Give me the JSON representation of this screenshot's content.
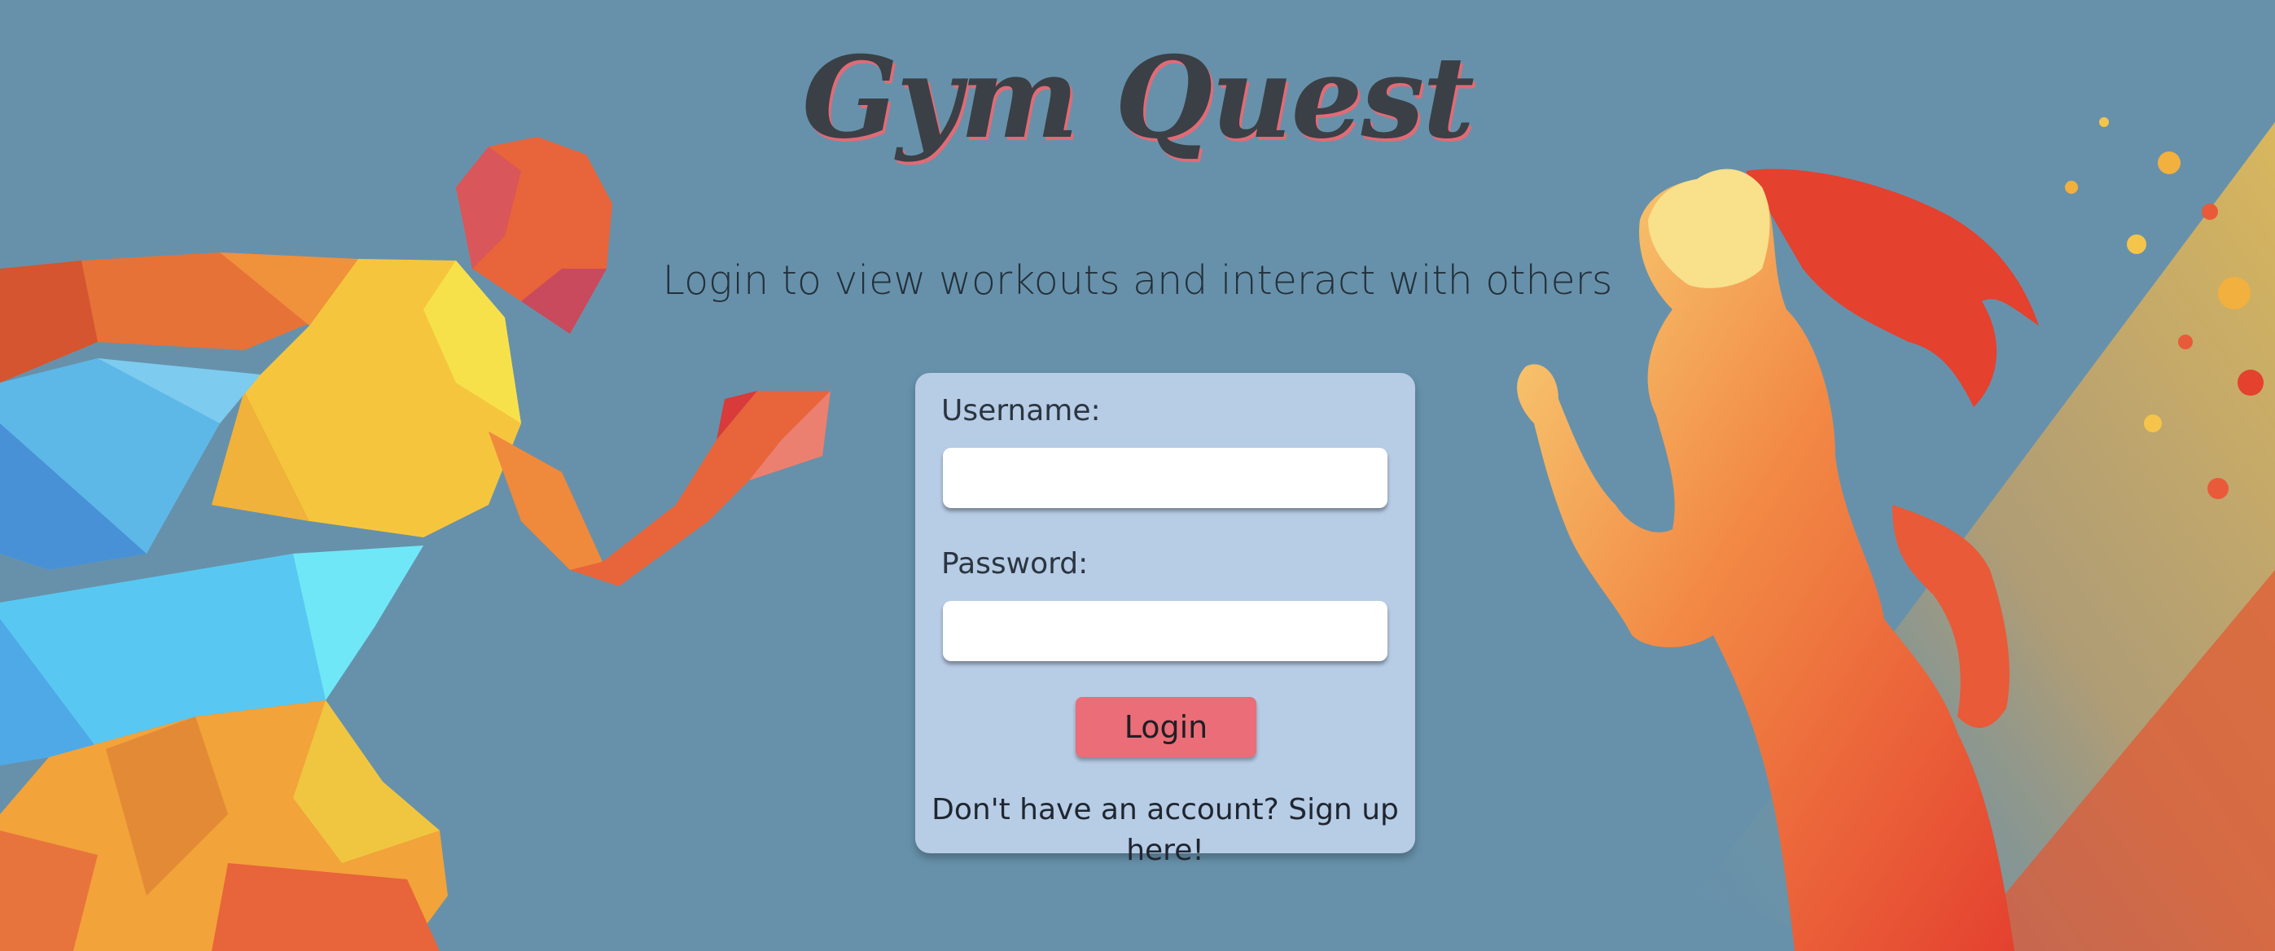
{
  "header": {
    "title": "Gym Quest",
    "subtitle": "Login to view workouts and interact with others"
  },
  "login_form": {
    "username_label": "Username:",
    "username_value": "",
    "password_label": "Password:",
    "password_value": "",
    "login_button_label": "Login",
    "signup_text": "Don't have an account? Sign up here!"
  },
  "illustrations": {
    "left": "low-poly-runner-illustration",
    "right": "watercolor-runner-illustration"
  },
  "colors": {
    "background": "#6791aa",
    "card": "#b7cce5",
    "button": "#ea6d77",
    "title": "#3a4046",
    "title_shadow": "#e06b76"
  }
}
